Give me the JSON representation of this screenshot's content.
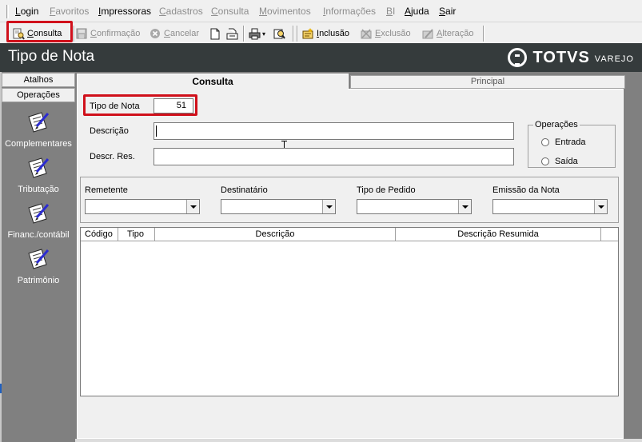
{
  "menu": {
    "items": [
      {
        "label": "Login",
        "underline": "L",
        "rest": "ogin",
        "disabled": false
      },
      {
        "label": "Favoritos",
        "underline": "F",
        "rest": "avoritos",
        "disabled": true
      },
      {
        "label": "Impressoras",
        "underline": "I",
        "rest": "mpressoras",
        "disabled": false
      },
      {
        "label": "Cadastros",
        "underline": "C",
        "rest": "adastros",
        "disabled": true
      },
      {
        "label": "Consulta",
        "underline": "C",
        "rest": "onsulta",
        "disabled": true
      },
      {
        "label": "Movimentos",
        "underline": "M",
        "rest": "ovimentos",
        "disabled": true
      },
      {
        "label": "Informações",
        "underline": "I",
        "rest": "nformações",
        "disabled": true
      },
      {
        "label": "BI",
        "underline": "B",
        "rest": "I",
        "disabled": true
      },
      {
        "label": "Ajuda",
        "underline": "A",
        "rest": "juda",
        "disabled": false
      },
      {
        "label": "Sair",
        "underline": "S",
        "rest": "air",
        "disabled": false
      }
    ]
  },
  "toolbar": {
    "consulta": {
      "underline": "C",
      "rest": "onsulta",
      "icon": "search-doc-icon"
    },
    "confirmacao": {
      "underline": "C",
      "rest": "onfirmação",
      "icon": "save-icon"
    },
    "cancelar": {
      "underline": "C",
      "rest": "ancelar",
      "icon": "cancel-icon"
    },
    "new_icon": "new-document-icon",
    "open_icon": "open-folder-icon",
    "print_icon": "printer-icon",
    "help_icon": "help-search-icon",
    "inclusao": {
      "underline": "I",
      "rest": "nclusão",
      "icon": "add-icon"
    },
    "exclusao": {
      "underline": "E",
      "rest": "xclusão",
      "icon": "delete-icon"
    },
    "alteracao": {
      "underline": "A",
      "rest": "lteração",
      "icon": "edit-icon"
    }
  },
  "header": {
    "title": "Tipo de Nota",
    "brand": "TOTVS",
    "brand_sub": "VAREJO"
  },
  "left_panel": {
    "tab_atalhos": "Atalhos",
    "tab_operacoes": "Operações",
    "items": [
      {
        "label": "Complementares"
      },
      {
        "label": "Tributação"
      },
      {
        "label": "Financ./contábil"
      },
      {
        "label": "Patrimônio"
      }
    ]
  },
  "tabs": {
    "consulta": "Consulta",
    "principal": "Principal"
  },
  "form": {
    "tipo_label": "Tipo de Nota",
    "tipo_value": "51",
    "descricao_label": "Descrição",
    "descricao_value": "",
    "descres_label": "Descr. Res.",
    "descres_value": "",
    "operacoes_legend": "Operações",
    "entrada": "Entrada",
    "saida": "Saída"
  },
  "filters": {
    "remetente": "Remetente",
    "destinatario": "Destinatário",
    "tipo_pedido": "Tipo de Pedido",
    "emissao": "Emissão da Nota"
  },
  "grid": {
    "columns": [
      "Código",
      "Tipo",
      "Descrição",
      "Descrição Resumida"
    ]
  },
  "colors": {
    "highlight": "#d0101b",
    "titlebar": "#353b3c",
    "panel_gray": "#808080"
  }
}
